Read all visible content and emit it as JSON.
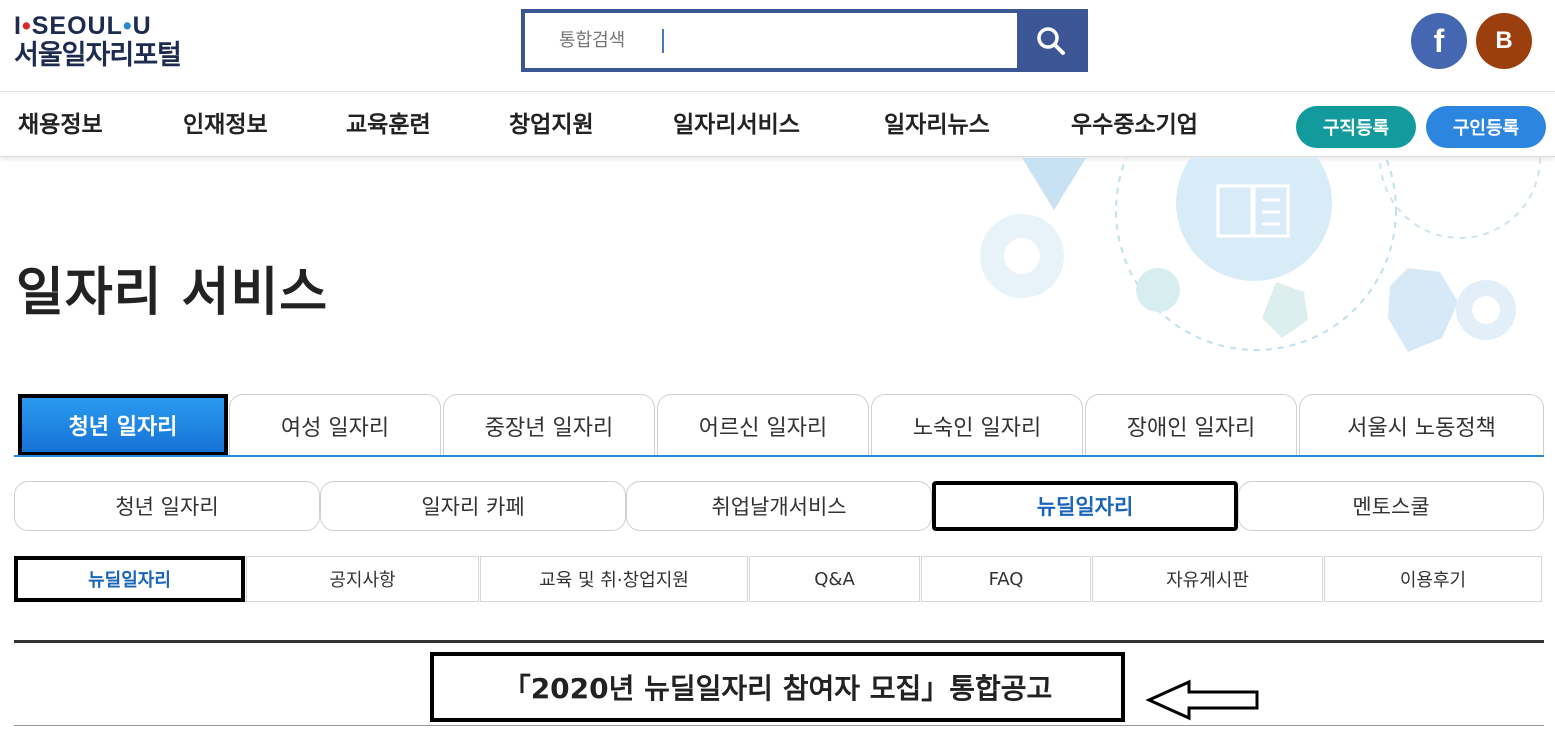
{
  "logo": {
    "top_prefix": "I",
    "top_mid": "SEOUL",
    "top_suffix": "U",
    "bottom": "서울일자리포털"
  },
  "search": {
    "placeholder": "통합검색",
    "button_icon": "search-icon"
  },
  "social": {
    "facebook_letter": "f",
    "blog_letter": "B"
  },
  "gnb": {
    "items": [
      "채용정보",
      "인재정보",
      "교육훈련",
      "창업지원",
      "일자리서비스",
      "일자리뉴스",
      "우수중소기업"
    ],
    "job_seek_button": "구직등록",
    "hire_button": "구인등록"
  },
  "page_title": "일자리 서비스",
  "tabs_level1": [
    "청년 일자리",
    "여성 일자리",
    "중장년 일자리",
    "어르신 일자리",
    "노숙인 일자리",
    "장애인 일자리",
    "서울시 노동정책"
  ],
  "tabs_level1_selected": "청년 일자리",
  "tabs_level2": [
    "청년 일자리",
    "일자리 카페",
    "취업날개서비스",
    "뉴딜일자리",
    "멘토스쿨"
  ],
  "tabs_level2_selected": "뉴딜일자리",
  "tabs_level3": [
    "뉴딜일자리",
    "공지사항",
    "교육 및 취·창업지원",
    "Q&A",
    "FAQ",
    "자유게시판",
    "이용후기"
  ],
  "tabs_level3_selected": "뉴딜일자리",
  "notice_title": "「2020년 뉴딜일자리 참여자 모집」통합공고",
  "colors": {
    "brand_navy": "#3c5594",
    "tab_blue": "#2a89d2",
    "job_pill": "#129a9d",
    "hire_pill": "#2c86e0",
    "facebook": "#4566b0",
    "blog": "#9c3f0f"
  }
}
